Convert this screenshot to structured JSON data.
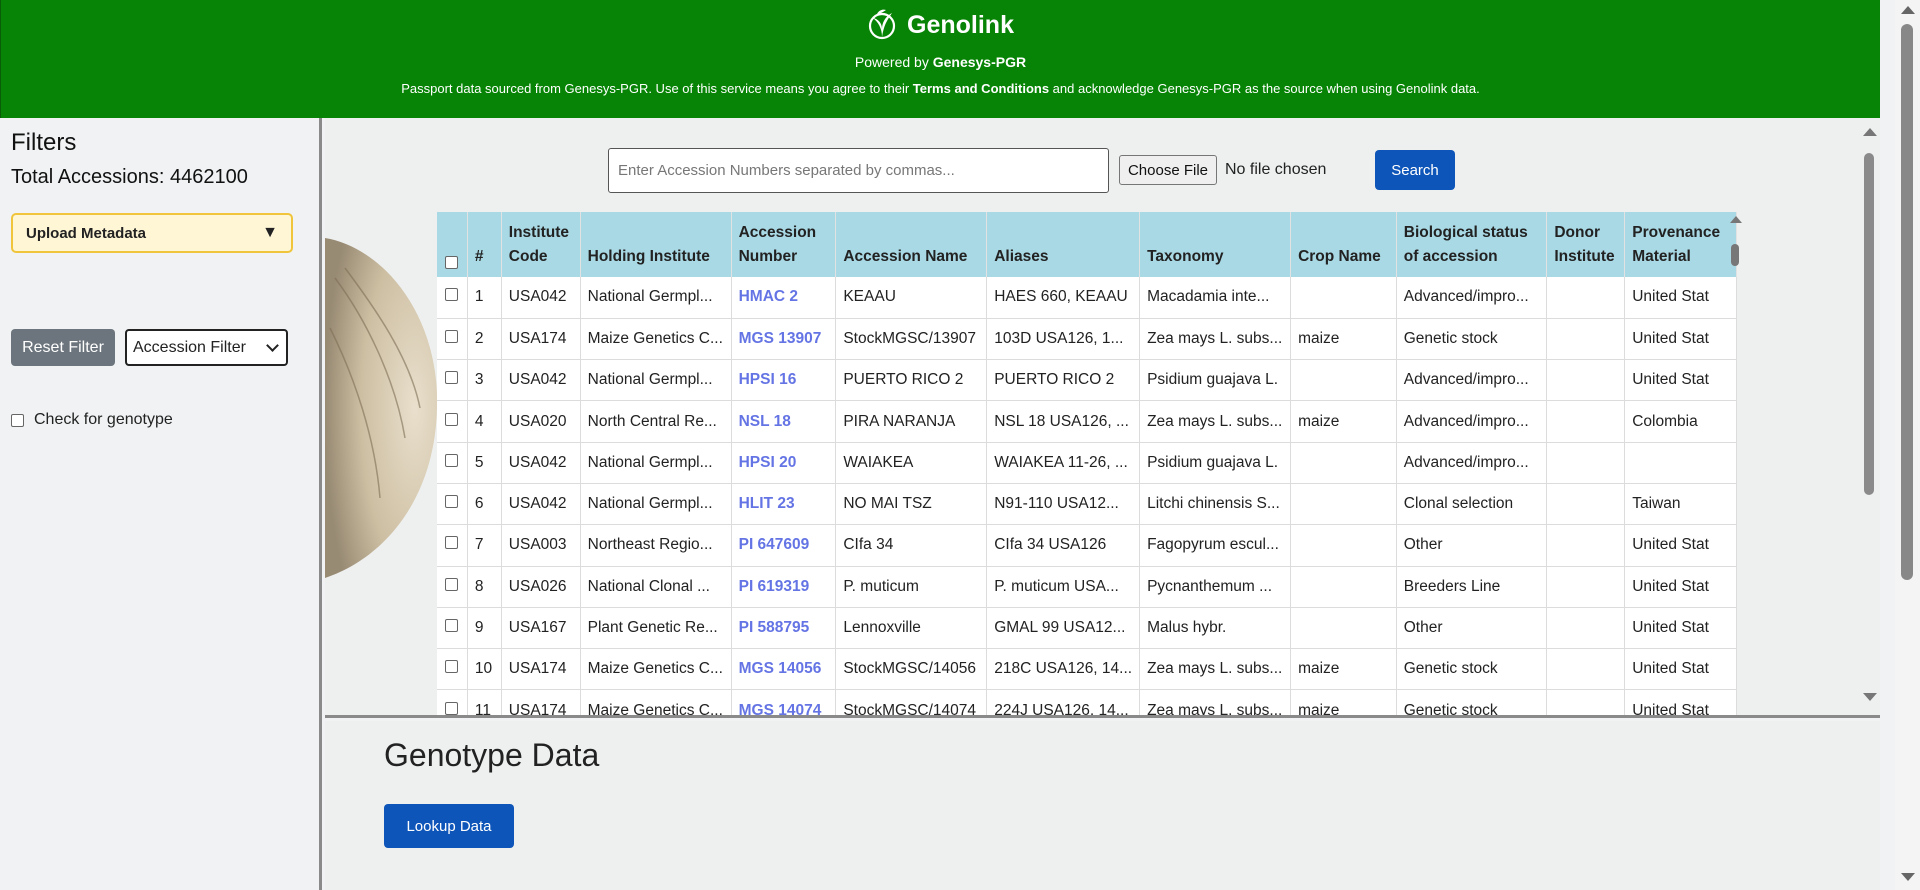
{
  "header": {
    "brand": "Genolink",
    "powered_prefix": "Powered by ",
    "powered_source": "Genesys-PGR",
    "notice_part1": "Passport data sourced from Genesys-PGR. Use of this service means you agree to their ",
    "notice_terms": "Terms and Conditions",
    "notice_part2": " and acknowledge Genesys-PGR as the source when using Genolink data.",
    "color": "#078405"
  },
  "sidebar": {
    "title": "Filters",
    "total_label": "Total Accessions: 4462100",
    "upload_label": "Upload Metadata",
    "reset_label": "Reset Filter",
    "filter_select": "Accession Filter",
    "genotype_check_label": "Check for genotype"
  },
  "search": {
    "placeholder": "Enter Accession Numbers separated by commas...",
    "file_button": "Choose File",
    "file_status": "No file chosen",
    "search_button": "Search"
  },
  "table": {
    "headers": {
      "num": "#",
      "institute_code": [
        "Institute",
        "Code"
      ],
      "holding_institute": "Holding Institute",
      "accession_number": [
        "Accession",
        "Number"
      ],
      "accession_name": "Accession Name",
      "aliases": "Aliases",
      "taxonomy": "Taxonomy",
      "crop_name": "Crop Name",
      "bio_status": [
        "Biological status",
        "of accession"
      ],
      "donor_institute": [
        "Donor",
        "Institute"
      ],
      "provenance": [
        "Provenance",
        "Material"
      ]
    },
    "rows": [
      {
        "n": "1",
        "code": "USA042",
        "holding": "National Germpl...",
        "acc": "HMAC 2",
        "name": "KEAAU",
        "aliases": "HAES 660, KEAAU",
        "tax": "Macadamia inte...",
        "crop": "",
        "bio": "Advanced/impro...",
        "donor": "",
        "prov": "United Stat"
      },
      {
        "n": "2",
        "code": "USA174",
        "holding": "Maize Genetics C...",
        "acc": "MGS 13907",
        "name": "StockMGSC/13907",
        "aliases": "103D USA126, 1...",
        "tax": "Zea mays L. subs...",
        "crop": "maize",
        "bio": "Genetic stock",
        "donor": "",
        "prov": "United Stat"
      },
      {
        "n": "3",
        "code": "USA042",
        "holding": "National Germpl...",
        "acc": "HPSI 16",
        "name": "PUERTO RICO 2",
        "aliases": "PUERTO RICO 2",
        "tax": "Psidium guajava L.",
        "crop": "",
        "bio": "Advanced/impro...",
        "donor": "",
        "prov": "United Stat"
      },
      {
        "n": "4",
        "code": "USA020",
        "holding": "North Central Re...",
        "acc": "NSL 18",
        "name": "PIRA NARANJA",
        "aliases": "NSL 18 USA126, ...",
        "tax": "Zea mays L. subs...",
        "crop": "maize",
        "bio": "Advanced/impro...",
        "donor": "",
        "prov": "Colombia"
      },
      {
        "n": "5",
        "code": "USA042",
        "holding": "National Germpl...",
        "acc": "HPSI 20",
        "name": "WAIAKEA",
        "aliases": "WAIAKEA 11-26, ...",
        "tax": "Psidium guajava L.",
        "crop": "",
        "bio": "Advanced/impro...",
        "donor": "",
        "prov": ""
      },
      {
        "n": "6",
        "code": "USA042",
        "holding": "National Germpl...",
        "acc": "HLIT 23",
        "name": "NO MAI TSZ",
        "aliases": "N91-110 USA12...",
        "tax": "Litchi chinensis S...",
        "crop": "",
        "bio": "Clonal selection",
        "donor": "",
        "prov": "Taiwan"
      },
      {
        "n": "7",
        "code": "USA003",
        "holding": "Northeast Regio...",
        "acc": "PI 647609",
        "name": "CIfa 34",
        "aliases": "CIfa 34 USA126",
        "tax": "Fagopyrum escul...",
        "crop": "",
        "bio": "Other",
        "donor": "",
        "prov": "United Stat"
      },
      {
        "n": "8",
        "code": "USA026",
        "holding": "National Clonal ...",
        "acc": "PI 619319",
        "name": "P. muticum",
        "aliases": "P. muticum USA...",
        "tax": "Pycnanthemum ...",
        "crop": "",
        "bio": "Breeders Line",
        "donor": "",
        "prov": "United Stat"
      },
      {
        "n": "9",
        "code": "USA167",
        "holding": "Plant Genetic Re...",
        "acc": "PI 588795",
        "name": "Lennoxville",
        "aliases": "GMAL 99 USA12...",
        "tax": "Malus hybr.",
        "crop": "",
        "bio": "Other",
        "donor": "",
        "prov": "United Stat"
      },
      {
        "n": "10",
        "code": "USA174",
        "holding": "Maize Genetics C...",
        "acc": "MGS 14056",
        "name": "StockMGSC/14056",
        "aliases": "218C USA126, 14...",
        "tax": "Zea mays L. subs...",
        "crop": "maize",
        "bio": "Genetic stock",
        "donor": "",
        "prov": "United Stat"
      },
      {
        "n": "11",
        "code": "USA174",
        "holding": "Maize Genetics C...",
        "acc": "MGS 14074",
        "name": "StockMGSC/14074",
        "aliases": "224J USA126, 14...",
        "tax": "Zea mays L. subs...",
        "crop": "maize",
        "bio": "Genetic stock",
        "donor": "",
        "prov": "United Stat"
      }
    ]
  },
  "genotype": {
    "title": "Genotype Data",
    "lookup_button": "Lookup Data"
  },
  "icons": {
    "brand": "leaf-logo-icon",
    "dropdown": "triangle-down-icon",
    "select": "chevron-down-icon"
  },
  "colors": {
    "header": "#078405",
    "primary_button": "#0d55b8",
    "table_header": "#a9d9e5",
    "link": "#6474e4",
    "upload_bg": "#fff6d6",
    "upload_border": "#f0c53c"
  }
}
